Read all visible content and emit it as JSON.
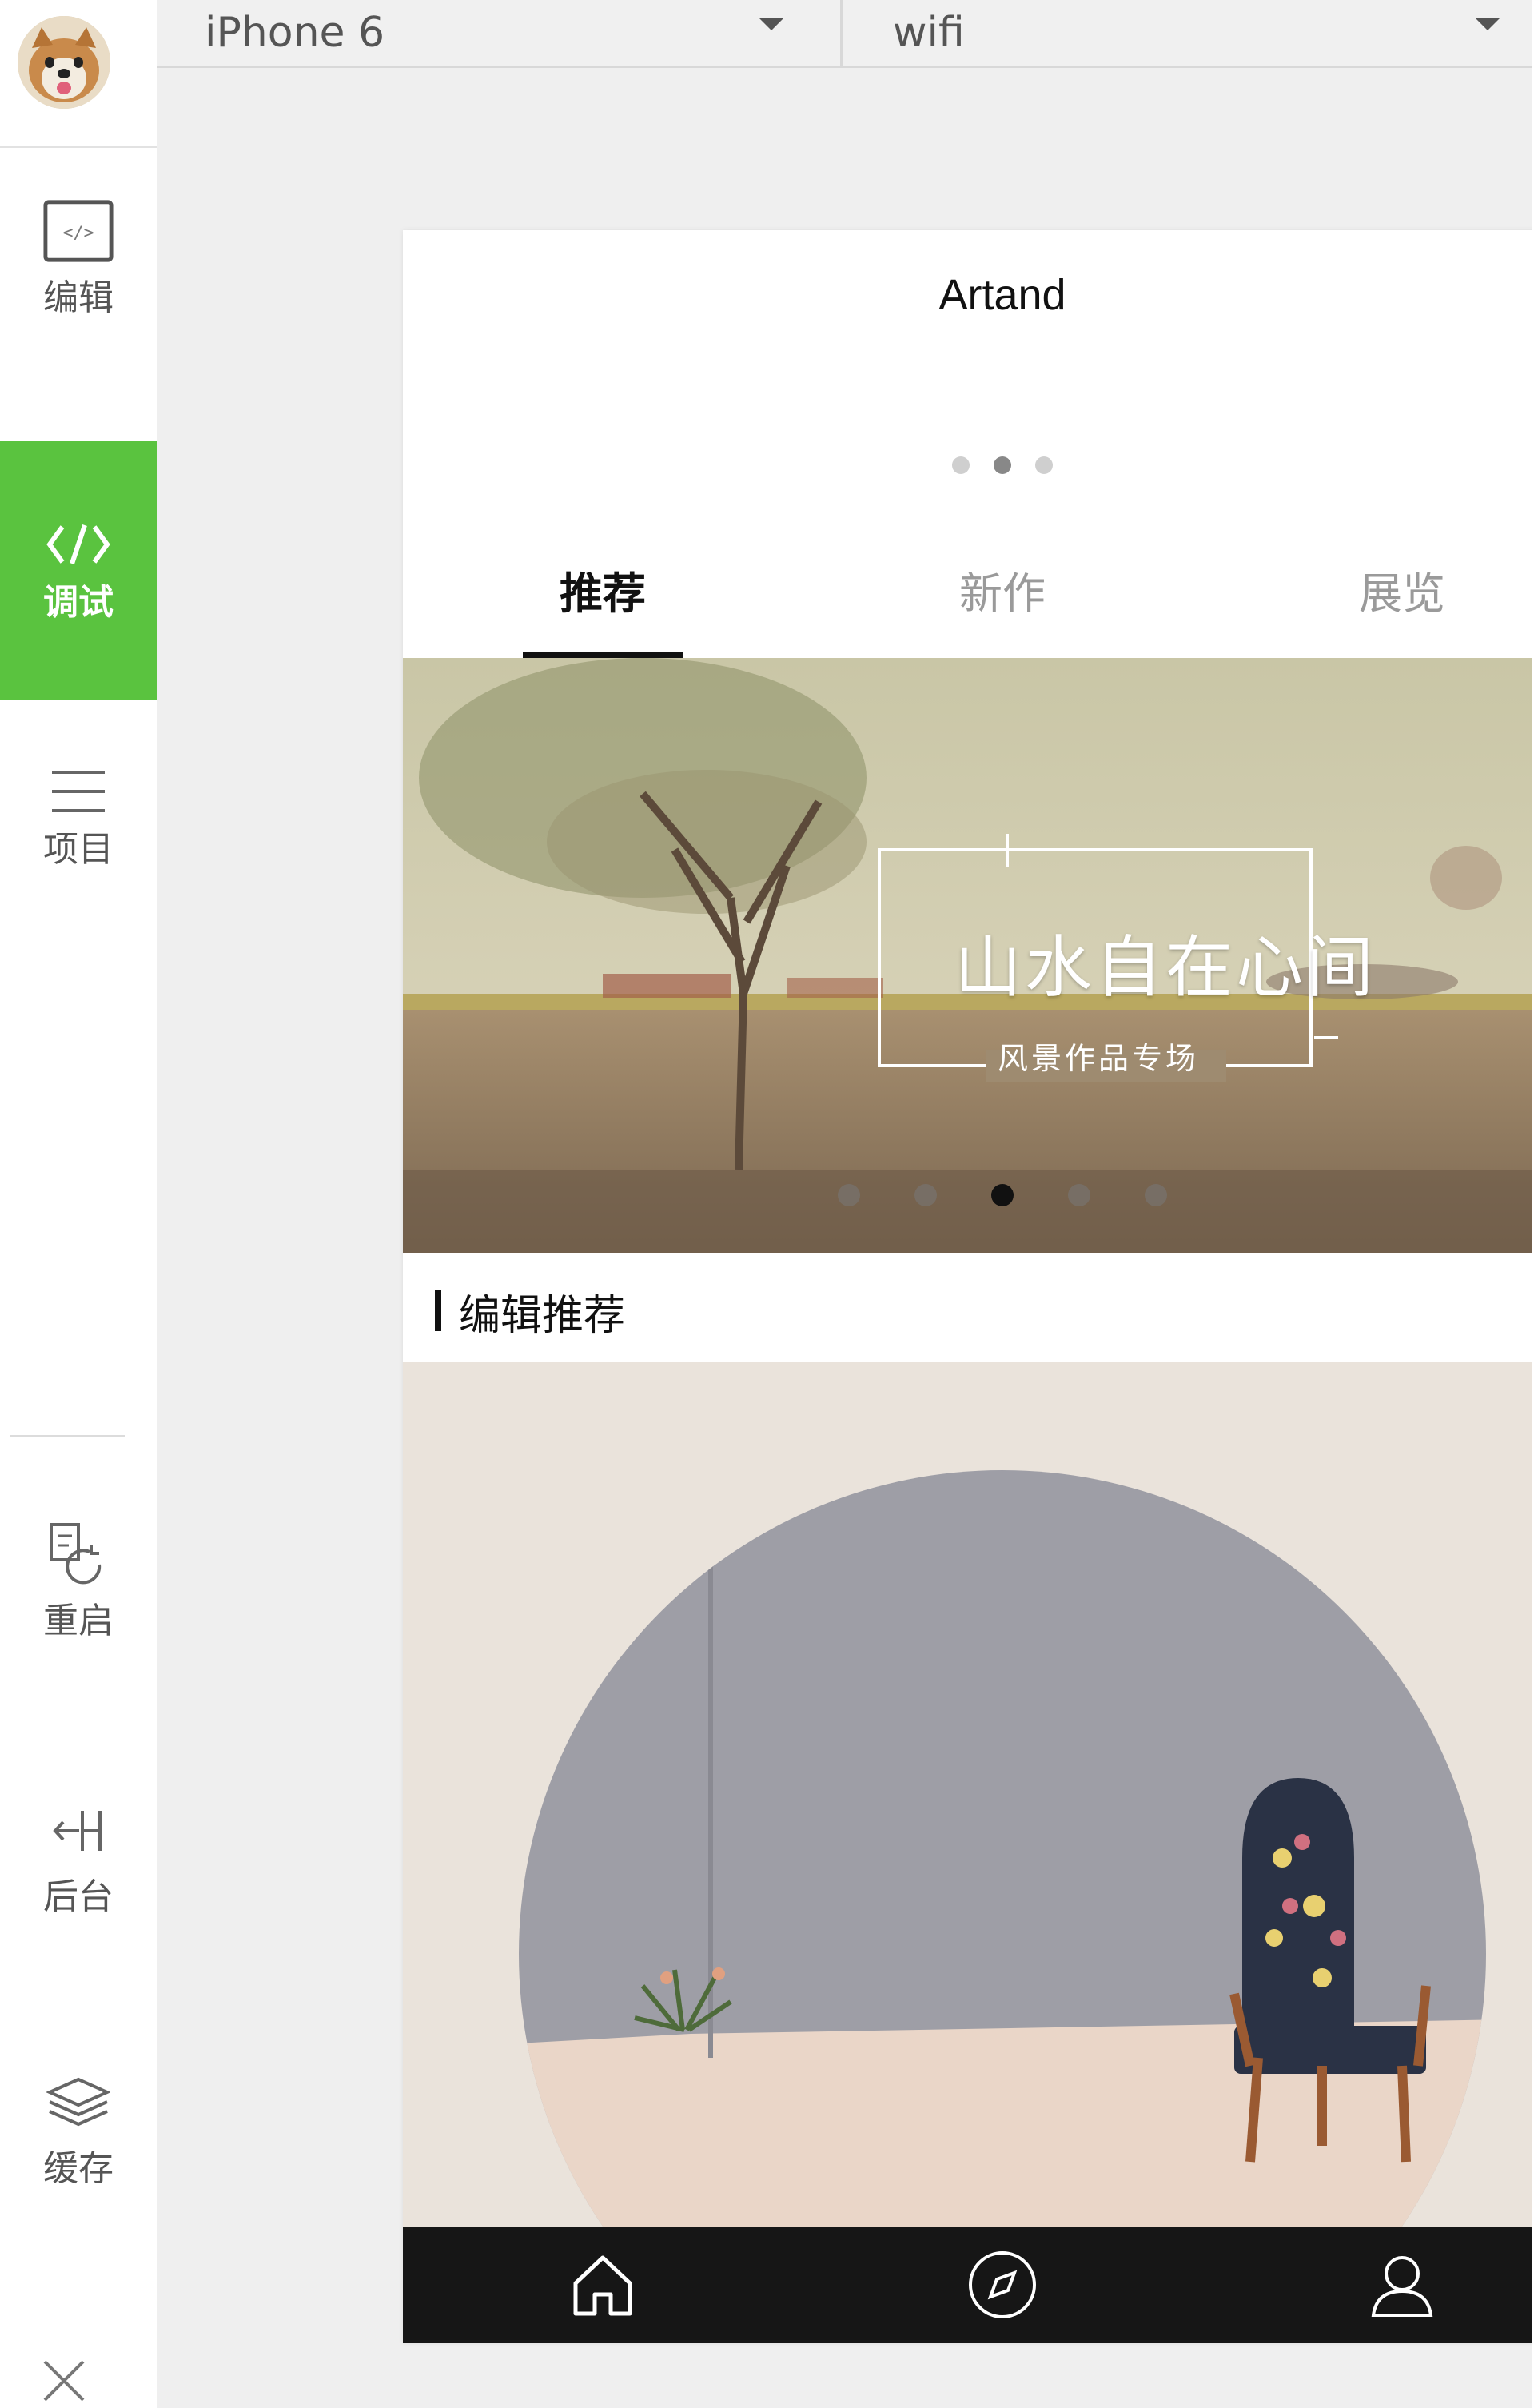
{
  "sidebar": {
    "tools": [
      {
        "label": "编辑",
        "icon": "code-file-icon"
      },
      {
        "label": "调试",
        "icon": "code-brackets-icon",
        "active": true
      },
      {
        "label": "项目",
        "icon": "menu-lines-icon"
      },
      {
        "label": "重启",
        "icon": "restart-icon"
      },
      {
        "label": "后台",
        "icon": "background-icon"
      },
      {
        "label": "缓存",
        "icon": "layers-icon"
      }
    ],
    "close_icon": "close-icon",
    "active_color": "#5ac33f"
  },
  "device_bar": {
    "device": "iPhone 6",
    "network": "wifi"
  },
  "phone": {
    "title": "Artand",
    "page_indicator": {
      "count": 3,
      "active": 1
    },
    "tabs": [
      {
        "label": "推荐",
        "active": true
      },
      {
        "label": "新作"
      },
      {
        "label": "展览"
      }
    ],
    "banner": {
      "title": "山水自在心间",
      "subtitle": "风景作品专场",
      "dots": {
        "count": 5,
        "active": 2
      }
    },
    "section_title": "编辑推荐",
    "tabbar": [
      "home-icon",
      "compass-icon",
      "user-icon"
    ]
  }
}
